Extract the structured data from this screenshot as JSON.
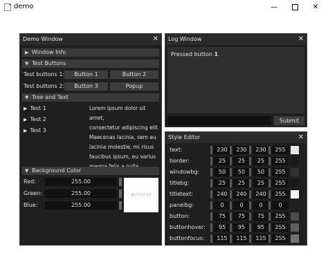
{
  "app": {
    "title": "demo"
  },
  "window_buttons": {
    "min": "—",
    "close": "✕"
  },
  "demo_window": {
    "title": "Demo Window",
    "close": "✕",
    "window_info_header": "Window Info",
    "test_buttons_header": "Test Buttons",
    "row1_label": "Test buttons 1:",
    "row2_label": "Test buttons 2:",
    "button1": "Button 1",
    "button2": "Button 2",
    "button3": "Button 3",
    "popup": "Popup",
    "tree_header": "Tree and Text",
    "tree_items": [
      "Test 1",
      "Test 2",
      "Test 3"
    ],
    "lorem_lines": [
      "Lorem ipsum dolor sit amet,",
      "consectetur adipiscing elit.",
      "Maecenas lacinia, sem eu",
      "lacinia molestie, mi risus",
      "faucibus ipsum, eu varius",
      "magna felis a nulla."
    ],
    "bg_header": "Background Color",
    "red_label": "Red:",
    "green_label": "Green:",
    "blue_label": "Blue:",
    "red_value": "255.00",
    "green_value": "255.00",
    "blue_value": "255.00",
    "hex": "#FFFFFF"
  },
  "log_window": {
    "title": "Log Window",
    "close": "✕",
    "message_prefix": "Pressed button ",
    "message_number": "1",
    "submit": "Submit"
  },
  "style_editor": {
    "title": "Style Editor",
    "close": "✕",
    "rows": [
      {
        "label": "text:",
        "v": [
          "230",
          "230",
          "230",
          "255"
        ],
        "swatch": "#e6e6e6"
      },
      {
        "label": "border:",
        "v": [
          "25",
          "25",
          "25",
          "255"
        ],
        "swatch": "#191919"
      },
      {
        "label": "windowbg:",
        "v": [
          "50",
          "50",
          "50",
          "255"
        ],
        "swatch": "#323232"
      },
      {
        "label": "titlebg:",
        "v": [
          "25",
          "25",
          "25",
          "255"
        ],
        "swatch": "#191919"
      },
      {
        "label": "titletext:",
        "v": [
          "240",
          "240",
          "240",
          "255"
        ],
        "swatch": "#f0f0f0"
      },
      {
        "label": "panelbg:",
        "v": [
          "0",
          "0",
          "0",
          "0"
        ],
        "swatch": ""
      },
      {
        "label": "button:",
        "v": [
          "75",
          "75",
          "75",
          "255"
        ],
        "swatch": "#4b4b4b"
      },
      {
        "label": "buttonhover:",
        "v": [
          "95",
          "95",
          "95",
          "255"
        ],
        "swatch": "#5f5f5f"
      },
      {
        "label": "buttonfocus:",
        "v": [
          "115",
          "115",
          "115",
          "255"
        ],
        "swatch": "#737373"
      }
    ]
  },
  "colors": {
    "accent": "#3a3a3a",
    "window_bg": "#1f1f1f",
    "title_bg": "#2b2b2b"
  }
}
